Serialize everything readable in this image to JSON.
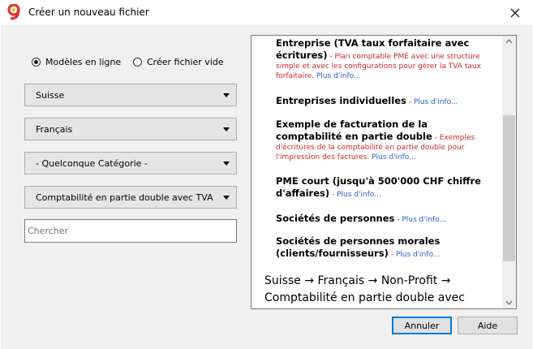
{
  "window": {
    "title": "Créer un nouveau fichier"
  },
  "radios": [
    {
      "label": "Modèles en ligne",
      "selected": true
    },
    {
      "label": "Créer fichier vide",
      "selected": false
    }
  ],
  "selects": [
    {
      "value": "Suisse"
    },
    {
      "value": "Français"
    },
    {
      "value": "- Quelconque Catégorie -"
    },
    {
      "value": "Comptabilité en partie double avec TVA"
    }
  ],
  "search": {
    "placeholder": "Chercher",
    "value": ""
  },
  "templates": [
    {
      "name": "Entreprise (TVA taux forfaitaire avec écritures)",
      "desc": " - Plan comptable PME avec une structure simple et avec les configurations pour gérer la TVA taux forfaitaire. ",
      "more": "Plus d'info..."
    },
    {
      "name": "Entreprises individuelles",
      "desc": " - ",
      "more": "Plus d'info..."
    },
    {
      "name": "Exemple de facturation de la comptabilité en partie double",
      "desc": " - Exemples d'écritures de la comptabilité en partie double pour l'impression des factures. ",
      "more": "Plus d'info..."
    },
    {
      "name": "PME court (jusqu'à 500'000 CHF chiffre d'affaires)",
      "desc": " - ",
      "more": "Plus d'info..."
    },
    {
      "name": "Sociétés de personnes",
      "desc": " - ",
      "more": "Plus d'info..."
    },
    {
      "name": "Sociétés de personnes morales (clients/fournisseurs)",
      "desc": " - ",
      "more": "Plus d'info..."
    }
  ],
  "next_group": {
    "path": "Suisse → Français → Non-Profit → Comptabilité en partie double avec"
  },
  "buttons": {
    "cancel": "Annuler",
    "help": "Aide"
  },
  "colors": {
    "link": "#2a5ccc",
    "description": "#cc2929",
    "focus_border": "#0078d7"
  }
}
